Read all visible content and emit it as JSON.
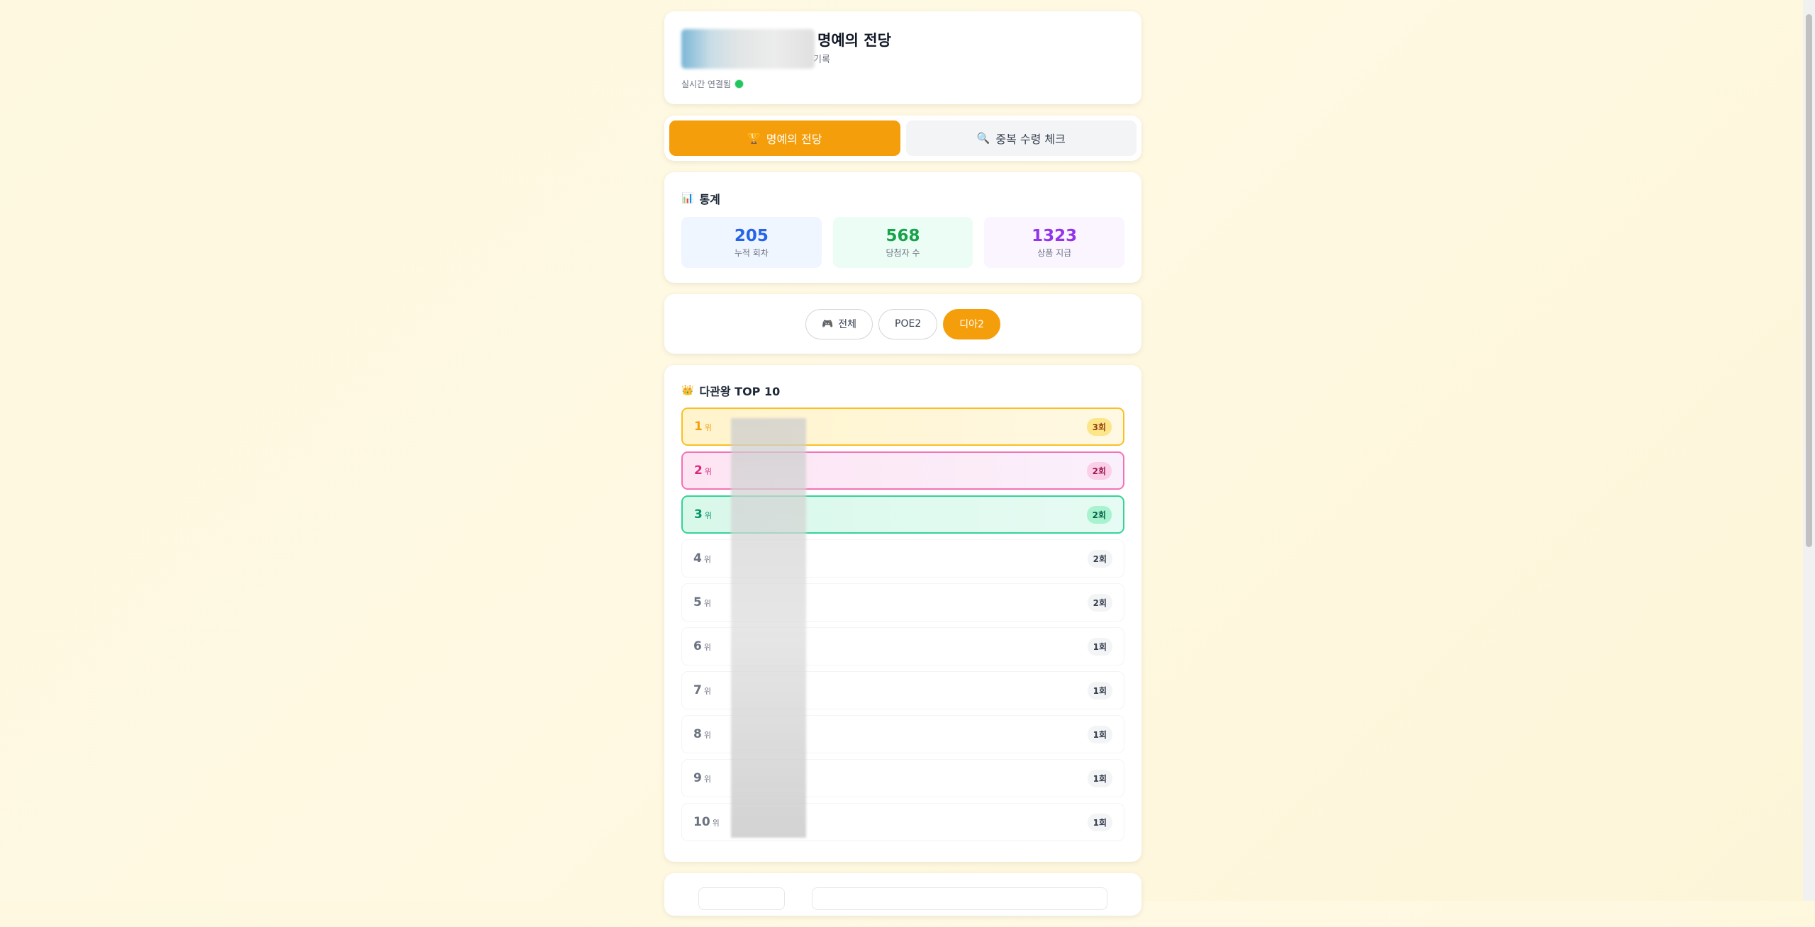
{
  "header": {
    "title": "명예의 전당",
    "subtitle": "기록",
    "live_status": "실시간 연결됨"
  },
  "tabs": [
    {
      "icon": "trophy-icon",
      "glyph": "🏆",
      "label": "명예의 전당",
      "active": true
    },
    {
      "icon": "search-icon",
      "glyph": "🔍",
      "label": "중복 수령 체크",
      "active": false
    }
  ],
  "stats": {
    "title": "통계",
    "glyph": "📊",
    "items": [
      {
        "value": "205",
        "label": "누적 회차"
      },
      {
        "value": "568",
        "label": "당첨자 수"
      },
      {
        "value": "1323",
        "label": "상품 지급"
      }
    ]
  },
  "filters": [
    {
      "glyph": "🎮",
      "label": "전체",
      "active": false
    },
    {
      "glyph": "",
      "label": "POE2",
      "active": false
    },
    {
      "glyph": "",
      "label": "디아2",
      "active": true
    }
  ],
  "ranking": {
    "title": "다관왕 TOP 10",
    "glyph": "👑",
    "unit": "위",
    "rows": [
      {
        "rank": "1",
        "count": "3회"
      },
      {
        "rank": "2",
        "count": "2회"
      },
      {
        "rank": "3",
        "count": "2회"
      },
      {
        "rank": "4",
        "count": "2회"
      },
      {
        "rank": "5",
        "count": "2회"
      },
      {
        "rank": "6",
        "count": "1회"
      },
      {
        "rank": "7",
        "count": "1회"
      },
      {
        "rank": "8",
        "count": "1회"
      },
      {
        "rank": "9",
        "count": "1회"
      },
      {
        "rank": "10",
        "count": "1회"
      }
    ]
  },
  "colors": {
    "accent": "#f59e0b",
    "gold": "#fbbf24",
    "pink": "#f472b6",
    "green": "#34d399",
    "live": "#22c55e"
  }
}
